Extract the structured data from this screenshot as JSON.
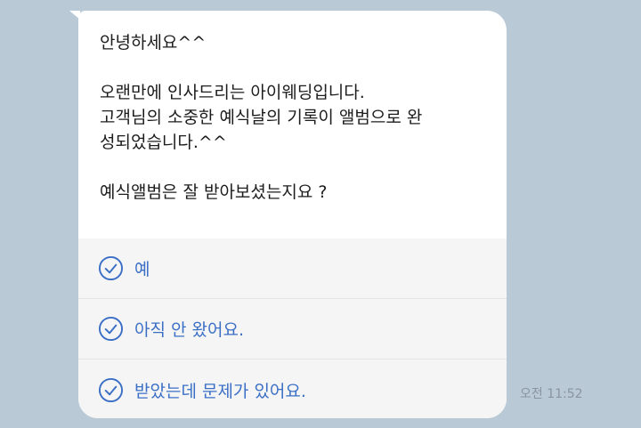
{
  "message": {
    "lines": [
      "안녕하세요^^",
      "",
      "오랜만에 인사드리는 아이웨딩입니다.",
      "고객님의 소중한 예식날의 기록이 앨범으로 완",
      "성되었습니다.^^",
      "",
      "예식앨범은 잘 받아보셨는지요 ?"
    ]
  },
  "options": [
    {
      "label": "예",
      "icon": "check-circle-icon"
    },
    {
      "label": "아직 안 왔어요.",
      "icon": "check-circle-icon"
    },
    {
      "label": "받았는데 문제가 있어요.",
      "icon": "check-circle-icon"
    }
  ],
  "timestamp": "오전 11:52",
  "colors": {
    "background": "#bac9d6",
    "bubble": "#ffffff",
    "option_background": "#f5f5f5",
    "option_text": "#3b6fc6",
    "timestamp": "#8a94a0"
  }
}
